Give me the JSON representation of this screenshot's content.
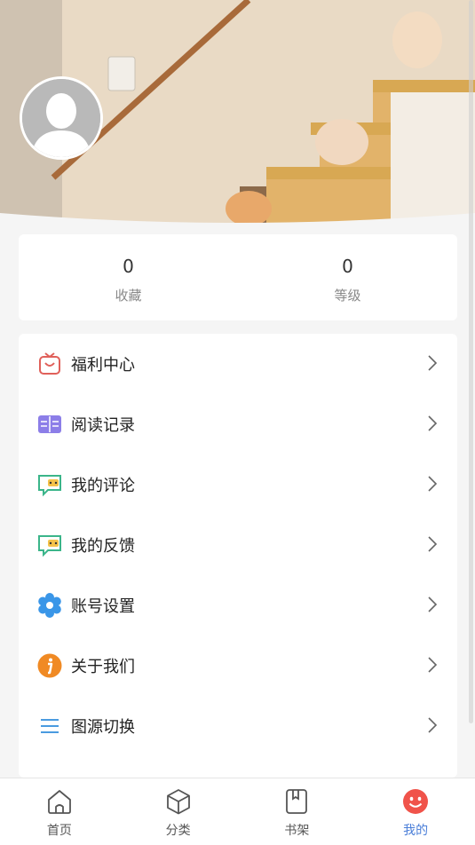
{
  "stats": [
    {
      "value": "0",
      "label": "收藏"
    },
    {
      "value": "0",
      "label": "等级"
    }
  ],
  "menu": [
    {
      "label": "福利中心",
      "icon": "gift-icon"
    },
    {
      "label": "阅读记录",
      "icon": "open-book-icon"
    },
    {
      "label": "我的评论",
      "icon": "comment-icon"
    },
    {
      "label": "我的反馈",
      "icon": "feedback-icon"
    },
    {
      "label": "账号设置",
      "icon": "gear-icon"
    },
    {
      "label": "关于我们",
      "icon": "info-icon"
    },
    {
      "label": "图源切换",
      "icon": "list-icon"
    }
  ],
  "tabs": [
    {
      "label": "首页",
      "icon": "home-icon"
    },
    {
      "label": "分类",
      "icon": "cube-icon"
    },
    {
      "label": "书架",
      "icon": "bookshelf-icon"
    },
    {
      "label": "我的",
      "icon": "smiley-icon"
    }
  ],
  "colors": {
    "active_tab": "#4a7ed8",
    "gift": "#e0605a",
    "book": "#8c7ee8",
    "comment": "#3bb58a",
    "gear": "#3a96e8",
    "info": "#f08a24",
    "list": "#4a9be0",
    "smiley": "#f0534a"
  }
}
